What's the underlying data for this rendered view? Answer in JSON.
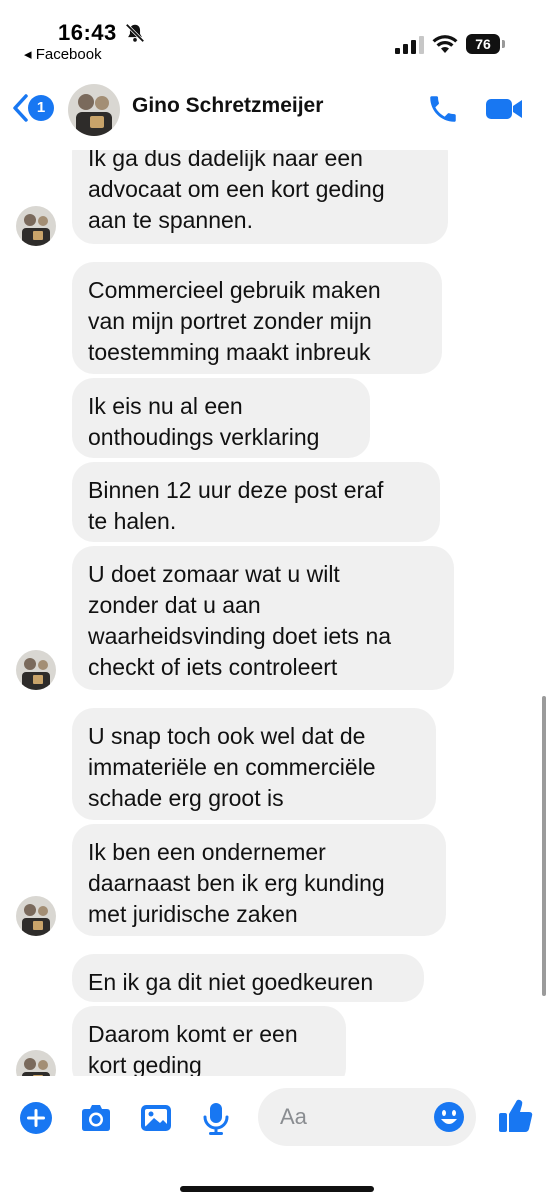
{
  "status_bar": {
    "time": "16:43",
    "back_app": "◂ Facebook",
    "battery": "76"
  },
  "header": {
    "back_badge": "1",
    "contact_name": "Gino Schretzmeijer",
    "icons": [
      "back-chevron-icon",
      "phone-icon",
      "video-camera-icon"
    ]
  },
  "messages": [
    {
      "lines": [
        "Ik ga dus dadelijk naar een",
        "advocaat om een kort geding",
        "aan te spannen."
      ]
    },
    {
      "lines": [
        "Commercieel gebruik maken",
        "van mijn portret zonder mijn",
        "toestemming maakt inbreuk"
      ]
    },
    {
      "lines": [
        "Ik eis nu al een",
        "onthoudings verklaring"
      ]
    },
    {
      "lines": [
        "Binnen 12 uur deze post eraf",
        "te halen."
      ]
    },
    {
      "lines": [
        "U doet zomaar wat u wilt",
        "zonder dat u aan",
        "waarheidsvinding doet iets na",
        "checkt of iets controleert"
      ]
    },
    {
      "lines": [
        "U snap toch ook wel dat de",
        "immateriële en commerciële",
        "schade erg groot is"
      ]
    },
    {
      "lines": [
        "Ik ben een ondernemer",
        "daarnaast ben ik erg kunding",
        "met juridische zaken"
      ]
    },
    {
      "lines": [
        "En ik ga dit niet goedkeuren"
      ]
    },
    {
      "lines": [
        "Daarom komt er een",
        "kort geding"
      ]
    }
  ],
  "composer": {
    "placeholder": "Aa",
    "icons": [
      "plus-icon",
      "camera-icon",
      "image-icon",
      "microphone-icon",
      "emoji-icon",
      "thumbs-up-icon"
    ]
  },
  "colors": {
    "accent": "#1877f2",
    "bubble": "#f0f0f0"
  }
}
